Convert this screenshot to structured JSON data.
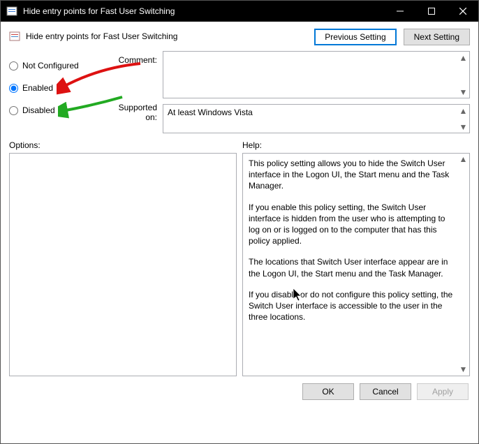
{
  "window": {
    "title": "Hide entry points for Fast User Switching"
  },
  "header": {
    "title": "Hide entry points for Fast User Switching",
    "previous_label": "Previous Setting",
    "next_label": "Next Setting"
  },
  "radios": {
    "not_configured": "Not Configured",
    "enabled": "Enabled",
    "disabled": "Disabled",
    "selected": "enabled"
  },
  "labels": {
    "comment": "Comment:",
    "supported_on": "Supported on:",
    "options": "Options:",
    "help": "Help:"
  },
  "supported_text": "At least Windows Vista",
  "help_paragraphs": {
    "p0": "This policy setting allows you to hide the Switch User interface in the Logon UI, the Start menu and the Task Manager.",
    "p1": "If you enable this policy setting, the Switch User interface is hidden from the user who is attempting to log on or is logged on to the computer that has this policy applied.",
    "p2": "The locations that Switch User interface appear are in the Logon UI, the Start menu and the Task Manager.",
    "p3": "If you disable or do not configure this policy setting, the Switch User interface is accessible to the user in the three locations."
  },
  "footer": {
    "ok": "OK",
    "cancel": "Cancel",
    "apply": "Apply"
  }
}
